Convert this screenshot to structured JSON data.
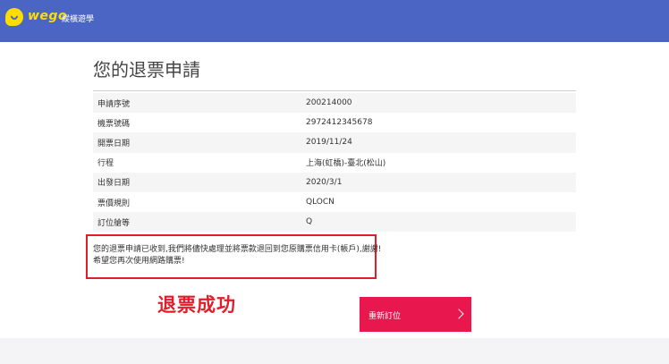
{
  "header": {
    "logo_text": "wego",
    "logo_subtitle": "縱橫遊學"
  },
  "page": {
    "title": "您的退票申請"
  },
  "details": [
    {
      "label": "申請序號",
      "value": "200214000"
    },
    {
      "label": "機票號碼",
      "value": "2972412345678"
    },
    {
      "label": "開票日期",
      "value": "2019/11/24"
    },
    {
      "label": "行程",
      "value": "上海(虹橋)-臺北(松山)"
    },
    {
      "label": "出發日期",
      "value": "2020/3/1"
    },
    {
      "label": "票價規則",
      "value": "QLOCN"
    },
    {
      "label": "訂位艙等",
      "value": "Q"
    }
  ],
  "notice": {
    "line1": "您的退票申請已收到,我們將儘快處理並將票款退回到您原購票信用卡(帳戶),謝謝!",
    "line2": "希望您再次使用網路購票!"
  },
  "annotation": {
    "success_text": "退票成功"
  },
  "actions": {
    "rebook_label": "重新訂位"
  },
  "colors": {
    "header": "#4a65c4",
    "logo": "#ffdd00",
    "accent_red": "#e11d27",
    "button": "#e8174d"
  }
}
